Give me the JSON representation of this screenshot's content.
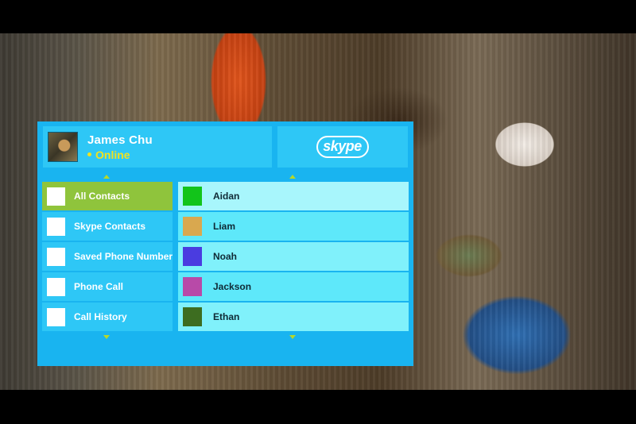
{
  "profile": {
    "name": "James Chu",
    "status": "Online"
  },
  "brand": {
    "logo_text": "skype"
  },
  "menu": {
    "items": [
      {
        "label": "All Contacts",
        "active": true
      },
      {
        "label": "Skype Contacts",
        "active": false
      },
      {
        "label": "Saved Phone Numbers",
        "active": false
      },
      {
        "label": "Phone Call",
        "active": false
      },
      {
        "label": "Call History",
        "active": false
      }
    ]
  },
  "contacts": {
    "items": [
      {
        "name": "Aidan",
        "color": "#12c41a"
      },
      {
        "name": "Liam",
        "color": "#d9a84f"
      },
      {
        "name": "Noah",
        "color": "#4a3ce0"
      },
      {
        "name": "Jackson",
        "color": "#b84aa8"
      },
      {
        "name": "Ethan",
        "color": "#3d6d20"
      }
    ]
  },
  "colors": {
    "panel": "#19b4f0",
    "tile": "#2ec7f6",
    "active_item": "#8fc43c",
    "status": "#f1e21e",
    "scroll_arrow": "#b5d82b"
  },
  "icons": {
    "scroll_up": "triangle-up",
    "scroll_down": "triangle-down",
    "status": "dot"
  }
}
